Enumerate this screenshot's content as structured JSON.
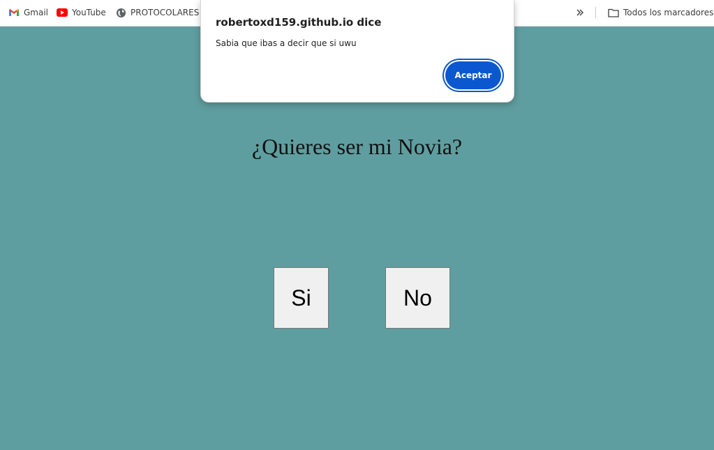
{
  "bookmarks": {
    "items": [
      {
        "label": "Gmail",
        "icon": "gmail-icon"
      },
      {
        "label": "YouTube",
        "icon": "youtube-icon"
      },
      {
        "label": "PROTOCOLARES",
        "icon": "globe-icon"
      }
    ],
    "overflow_icon": "double-chevron-right-icon",
    "all_bookmarks": {
      "label": "Todos los marcadores",
      "icon": "folder-icon"
    }
  },
  "page": {
    "background": "#5f9ea0",
    "question": "¿Quieres ser mi Novia?",
    "yes_label": "Si",
    "no_label": "No"
  },
  "alert": {
    "title": "robertoxd159.github.io dice",
    "message": "Sabia que ibas a decir que si uwu",
    "ok_label": "Aceptar",
    "accent": "#0b57d0"
  }
}
